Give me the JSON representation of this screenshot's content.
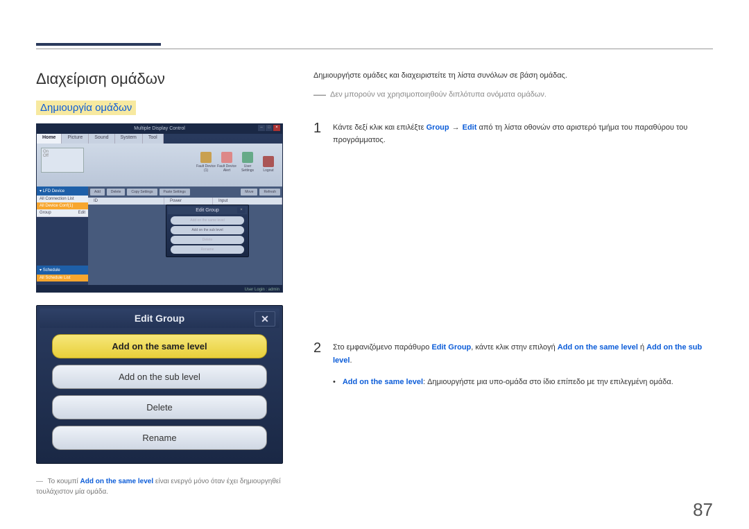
{
  "page_number": "87",
  "heading": "Διαχείριση ομάδων",
  "subheading": "Δημιουργία ομάδων",
  "intro": "Δημιουργήστε ομάδες και διαχειριστείτε τη λίστα συνόλων σε βάση ομάδας.",
  "note": "Δεν μπορούν να χρησιμοποιηθούν διπλότυπα ονόματα ομάδων.",
  "step1": {
    "num": "1",
    "pre": "Κάντε δεξί κλικ και επιλέξτε ",
    "kw1": "Group",
    "arrow": "→",
    "kw2": "Edit",
    "post": " από τη λίστα οθονών στο αριστερό τμήμα του παραθύρου του προγράμματος."
  },
  "step2": {
    "num": "2",
    "pre": "Στο εμφανιζόμενο παράθυρο ",
    "kw1": "Edit Group",
    "mid": ", κάντε κλικ στην επιλογή ",
    "kw2": "Add on the same level",
    "or": " ή ",
    "kw3": "Add on the sub level",
    "post": "."
  },
  "bullet": {
    "kw": "Add on the same level",
    "text": ": Δημιουργήστε μια υπο-ομάδα στο ίδιο επίπεδο με την επιλεγμένη ομάδα."
  },
  "footnote": {
    "pre": "Το κουμπί ",
    "kw": "Add on the same level",
    "post": " είναι ενεργό μόνο όταν έχει δημιουργηθεί τουλάχιστον μία ομάδα."
  },
  "screenshot1": {
    "title": "Multiple Display Control",
    "tabs": [
      "Home",
      "Picture",
      "Sound",
      "System",
      "Tool"
    ],
    "onoff": {
      "on": "On",
      "off": "Off"
    },
    "icons": [
      {
        "label": "Fault Device (1)",
        "color": "#c9a050"
      },
      {
        "label": "Fault Device Alert",
        "color": "#d88"
      },
      {
        "label": "User Settings",
        "color": "#6a8"
      },
      {
        "label": "Logout",
        "color": "#a55"
      }
    ],
    "side": {
      "lfd": "LFD Device",
      "conn": "All Connection List",
      "alldev": "All Device Conf(1)",
      "group": "Group",
      "edit": "Edit",
      "sched": "Schedule",
      "schedlist": "All Schedule List"
    },
    "toolbar": [
      "Add",
      "Delete",
      "Copy Settings",
      "Paste Settings",
      "Move",
      "Refresh"
    ],
    "thead": [
      "ID",
      "Power",
      "Input"
    ],
    "popup": {
      "title": "Edit Group",
      "btns": [
        "Add on the same level",
        "Add on the sub level",
        "Delete",
        "Rename"
      ]
    },
    "status": "User Login : admin"
  },
  "screenshot2": {
    "title": "Edit Group",
    "close": "✕",
    "btns": [
      "Add on the same level",
      "Add on the sub level",
      "Delete",
      "Rename"
    ]
  }
}
